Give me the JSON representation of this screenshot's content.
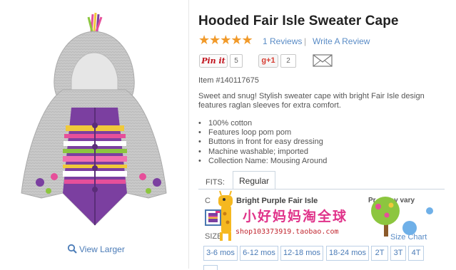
{
  "product": {
    "title": "Hooded Fair Isle Sweater Cape",
    "rating_stars": 5,
    "reviews_label": "1 Reviews",
    "separator": "|",
    "write_review_label": "Write A Review",
    "item_number": "Item #140117675",
    "description": "Sweet and snug! Stylish sweater cape with bright Fair Isle design features raglan sleeves for extra comfort.",
    "bullets": [
      "100% cotton",
      "Features loop pom pom",
      "Buttons in front for easy dressing",
      "Machine washable; imported",
      "Collection Name: Mousing Around"
    ]
  },
  "image": {
    "view_larger_label": "View Larger"
  },
  "share": {
    "pinit_label": "Pin it",
    "pinit_count": "5",
    "gplus_label": "g+1",
    "gplus_count": "2"
  },
  "fits": {
    "label": "FITS:",
    "tabs": [
      {
        "label": "Regular",
        "selected": true
      }
    ]
  },
  "color": {
    "label": "C",
    "selected_name": "Bright Purple Fair Isle",
    "price_note": "Pr  s may vary"
  },
  "size": {
    "label": "SIZE",
    "chart_label": "Size Chart",
    "options": [
      "3-6 mos",
      "6-12 mos",
      "12-18 mos",
      "18-24 mos",
      "2T",
      "3T",
      "4T"
    ]
  },
  "watermark": {
    "shop_name": "小好妈妈淘全球",
    "shop_url": "shop103373919.taobao.com"
  },
  "colors": {
    "accent_link": "#4a7bb7",
    "star": "#f19a2a",
    "pin_red": "#c1121c",
    "gplus_red": "#d73d32"
  }
}
